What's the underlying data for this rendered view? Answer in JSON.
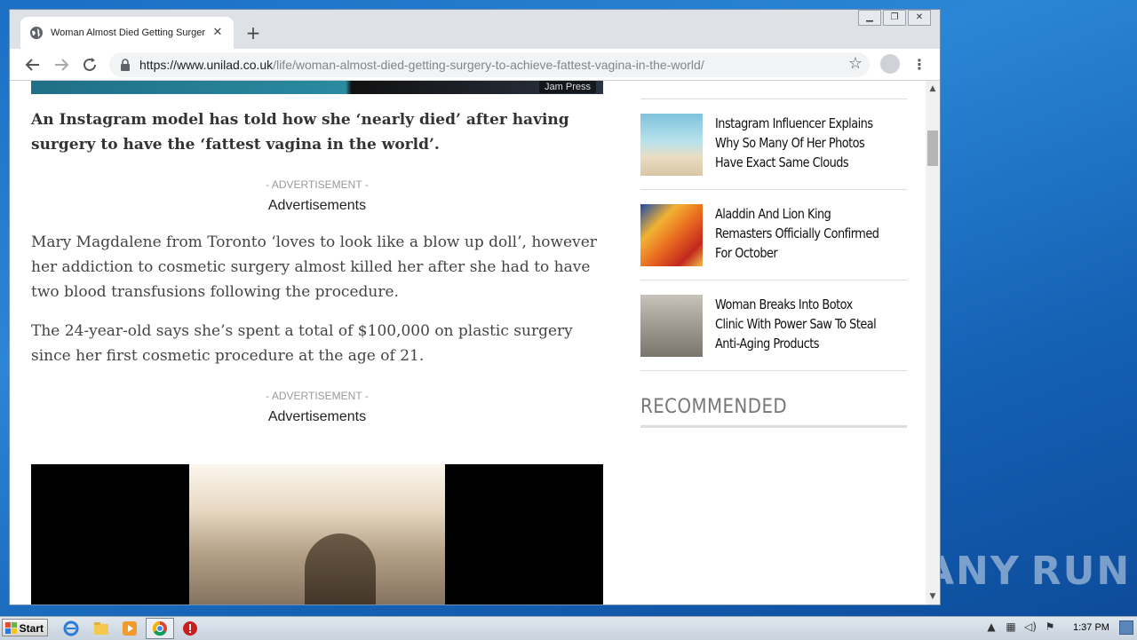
{
  "browser": {
    "tab_title": "Woman Almost Died Getting Surgery To Achieve Fattest Vagina In The World",
    "url_host": "https://www.unilad.co.uk",
    "url_path": "/life/woman-almost-died-getting-surgery-to-achieve-fattest-vagina-in-the-world/",
    "new_tab_glyph": "+",
    "close_glyph": "✕"
  },
  "window_controls": {
    "minimize": "▁",
    "restore": "❐",
    "close": "✕"
  },
  "article": {
    "hero_credit": "Jam Press",
    "lead": "An Instagram model has told how she ‘nearly died’ after having surgery to have the ‘fattest vagina in the world’.",
    "ad1_label": "- ADVERTISEMENT -",
    "ad1_text": "Advertisements",
    "para1": "Mary Magdalene from Toronto ‘loves to look like a blow up doll’, however her addiction to cosmetic surgery almost killed her after she had to have two blood transfusions following the procedure.",
    "para2": "The 24-year-old says she’s spent a total of $100,000 on plastic surgery since her first cosmetic procedure at the age of 21.",
    "ad2_label": "- ADVERTISEMENT -",
    "ad2_text": "Advertisements"
  },
  "sidebar": {
    "items": [
      {
        "title": "Instagram Influencer Explains Why So Many Of Her Photos Have Exact Same Clouds",
        "thumb_color": "#8cc6d9"
      },
      {
        "title": "Aladdin And Lion King Remasters Officially Confirmed For October",
        "thumb_color": "#e8862a"
      },
      {
        "title": "Woman Breaks Into Botox Clinic With Power Saw To Steal Anti-Aging Products",
        "thumb_color": "#a9a49a"
      }
    ],
    "recommended": "RECOMMENDED"
  },
  "taskbar": {
    "start_label": "Start",
    "clock": "1:37 PM"
  },
  "watermark": {
    "left": "ANY",
    "right": "RUN"
  }
}
